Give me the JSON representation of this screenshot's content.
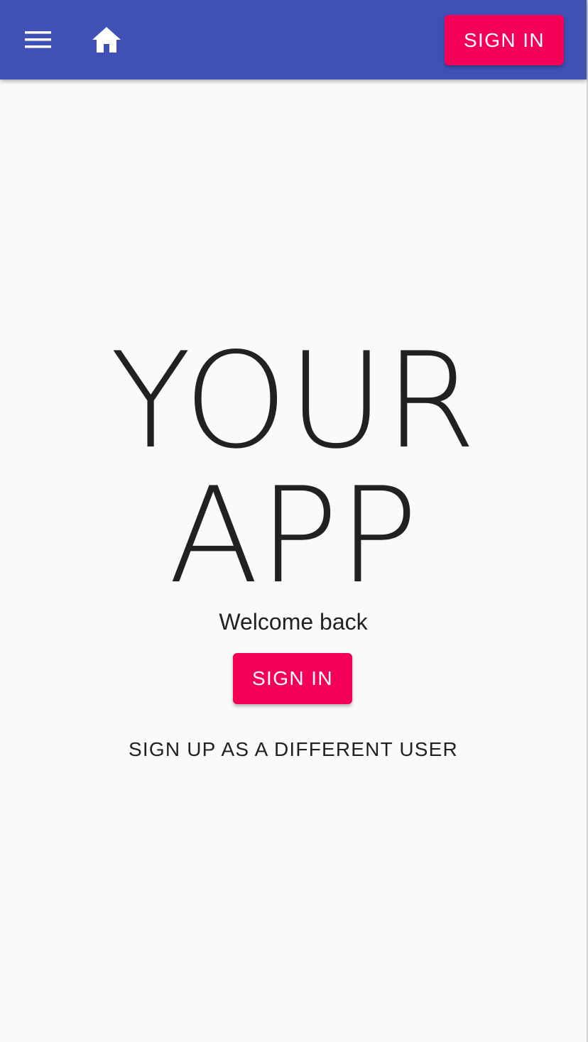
{
  "appbar": {
    "menu_icon": "hamburger-menu-icon",
    "home_icon": "home-icon",
    "signin_label": "SIGN IN"
  },
  "hero": {
    "title_line1": "YOUR",
    "title_line2": "APP",
    "welcome": "Welcome back",
    "signin_label": "SIGN IN",
    "signup_label": "SIGN UP AS A DIFFERENT USER"
  },
  "colors": {
    "primary": "#3f51b5",
    "accent": "#f50057",
    "text": "#212121",
    "background": "#fafafa"
  }
}
